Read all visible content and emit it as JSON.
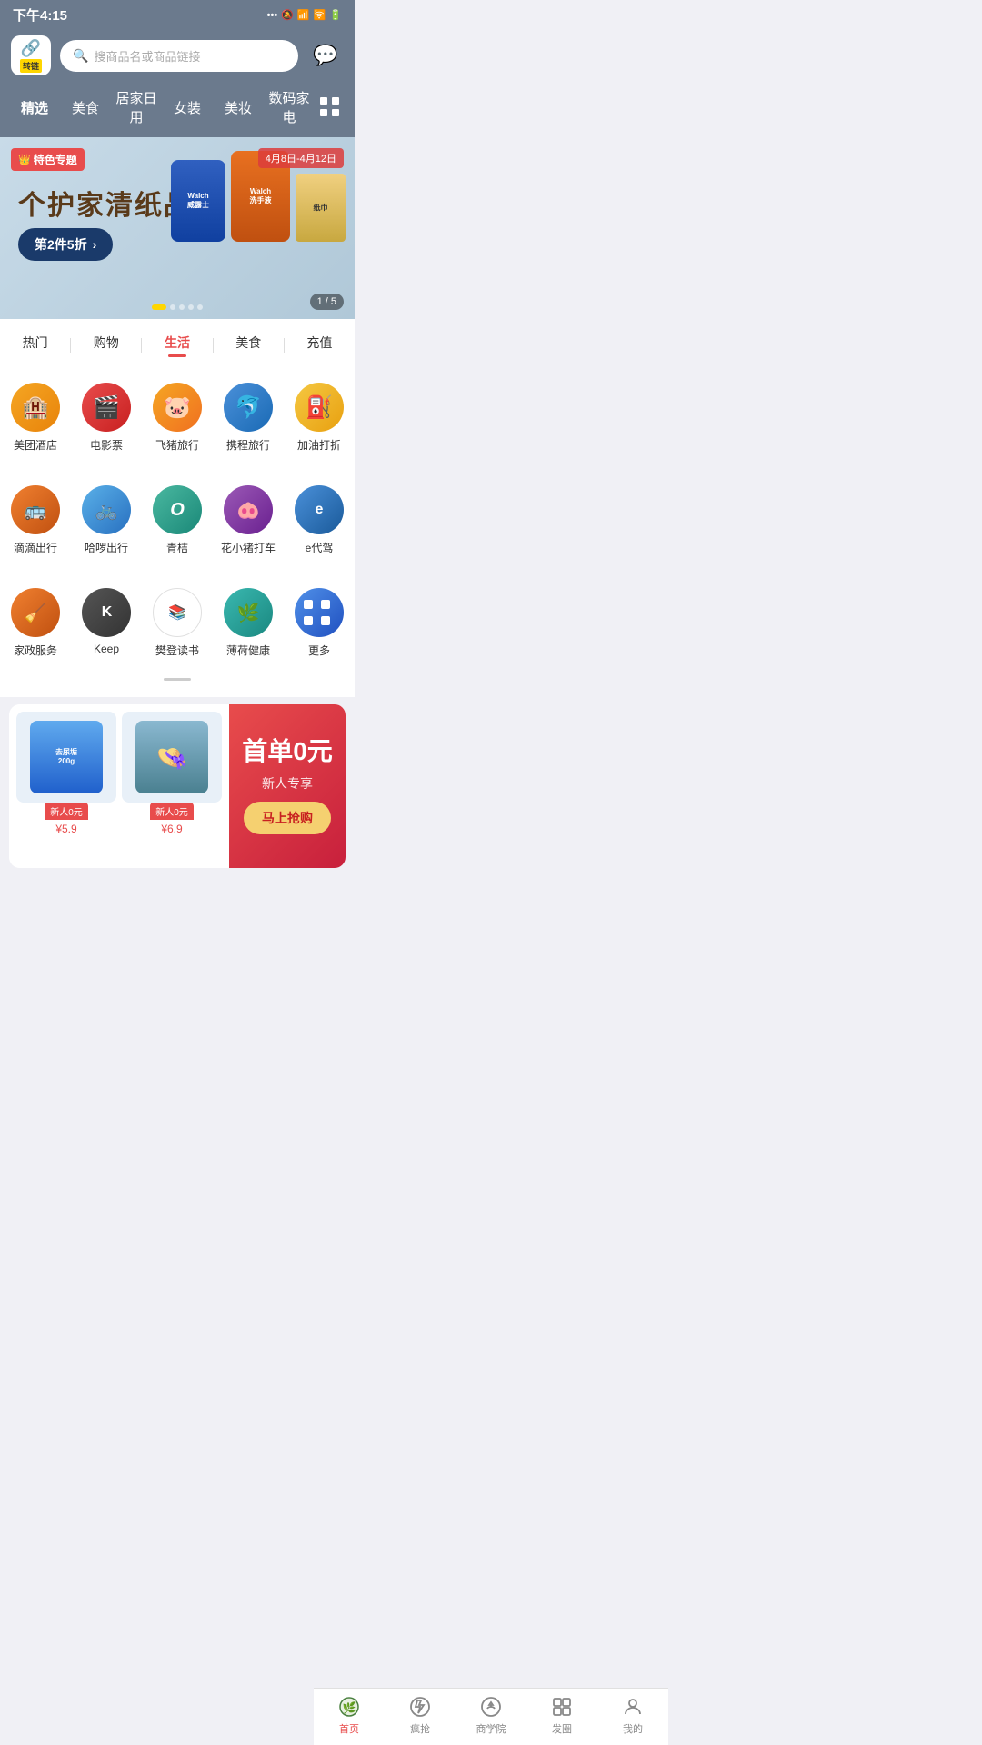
{
  "statusBar": {
    "time": "下午4:15",
    "icons": "... 🔕 📶 WiFi 🔋"
  },
  "header": {
    "logoLabel": "转链",
    "searchPlaceholder": "搜商品名或商品链接"
  },
  "navTabs": {
    "items": [
      "精选",
      "美食",
      "居家日用",
      "女装",
      "美妆",
      "数码家电"
    ]
  },
  "banner": {
    "tag": "特色专题",
    "date": "4月8日-4月12日",
    "title": "个护家清纸品",
    "ctaLabel": "第2件5折",
    "counter": "1 / 5"
  },
  "categoryTabs": {
    "items": [
      "热门",
      "购物",
      "生活",
      "美食",
      "充值"
    ],
    "activeIndex": 2
  },
  "services": {
    "rows": [
      [
        {
          "label": "美团酒店",
          "icon": "🏨",
          "color": "ic-orange"
        },
        {
          "label": "电影票",
          "icon": "🎬",
          "color": "ic-red"
        },
        {
          "label": "飞猪旅行",
          "icon": "🐷",
          "color": "ic-orange2"
        },
        {
          "label": "携程旅行",
          "icon": "🐬",
          "color": "ic-blue"
        },
        {
          "label": "加油打折",
          "icon": "⛽",
          "color": "ic-amber"
        }
      ],
      [
        {
          "label": "滴滴出行",
          "icon": "🚖",
          "color": "ic-orange3"
        },
        {
          "label": "哈啰出行",
          "icon": "🚲",
          "color": "ic-blue2"
        },
        {
          "label": "青桔",
          "icon": "🍊",
          "color": "ic-teal"
        },
        {
          "label": "花小猪打车",
          "icon": "🐷",
          "color": "ic-purple"
        },
        {
          "label": "e代驾",
          "icon": "🚗",
          "color": "ic-blue3"
        }
      ],
      [
        {
          "label": "家政服务",
          "icon": "🧹",
          "color": "ic-orange3"
        },
        {
          "label": "Keep",
          "icon": "K",
          "color": "ic-dark"
        },
        {
          "label": "樊登读书",
          "icon": "📚",
          "color": "ic-white"
        },
        {
          "label": "薄荷健康",
          "icon": "🌿",
          "color": "ic-teal2"
        },
        {
          "label": "更多",
          "icon": "⊞",
          "color": "ic-blue4"
        }
      ]
    ]
  },
  "promo": {
    "items": [
      {
        "badge": "新人0元",
        "price": "¥5.9"
      },
      {
        "badge": "新人0元",
        "price": "¥6.9"
      }
    ],
    "rightTitle": "首单0元",
    "rightSub": "新人专享",
    "rightBtn": "马上抢购"
  },
  "bottomNav": {
    "items": [
      {
        "label": "首页",
        "icon": "🏠",
        "active": true
      },
      {
        "label": "疯抢",
        "icon": "🔥",
        "active": false
      },
      {
        "label": "商学院",
        "icon": "👑",
        "active": false
      },
      {
        "label": "发圈",
        "icon": "⊞",
        "active": false
      },
      {
        "label": "我的",
        "icon": "👤",
        "active": false
      }
    ]
  }
}
